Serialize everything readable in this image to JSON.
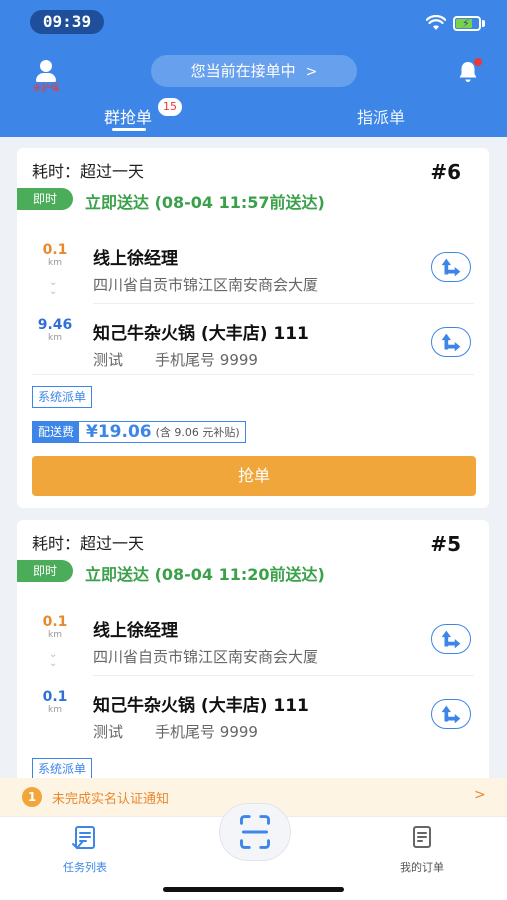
{
  "status_bar": {
    "time": "09:39"
  },
  "header": {
    "user_status": "未护保",
    "accepting_status": "您当前在接单中",
    "tabs": [
      {
        "label": "群抢单",
        "badge": "15",
        "active": true
      },
      {
        "label": "指派单",
        "active": false
      }
    ]
  },
  "orders": [
    {
      "elapsed": "耗时：超过一天",
      "number": "#6",
      "tag": "即时",
      "deliver": "立即送达 (08-04 11:57前送达)",
      "pickup": {
        "distance": "0.1",
        "unit": "km",
        "name": "线上徐经理",
        "address": "四川省自贡市锦江区南安商会大厦"
      },
      "dropoff": {
        "distance": "9.46",
        "unit": "km",
        "name": "知己牛杂火锅 (大丰店) 111",
        "contact": "测试",
        "phone": "手机尾号 9999"
      },
      "dispatch_tag": "系统派单",
      "fee_label": "配送费",
      "fee_value": "¥19.06",
      "fee_note": "(含 9.06 元补贴)",
      "grab_label": "抢单"
    },
    {
      "elapsed": "耗时：超过一天",
      "number": "#5",
      "tag": "即时",
      "deliver": "立即送达 (08-04 11:20前送达)",
      "pickup": {
        "distance": "0.1",
        "unit": "km",
        "name": "线上徐经理",
        "address": "四川省自贡市锦江区南安商会大厦"
      },
      "dropoff": {
        "distance": "0.1",
        "unit": "km",
        "name": "知己牛杂火锅 (大丰店) 111",
        "contact": "测试",
        "phone": "手机尾号 9999"
      },
      "dispatch_tag": "系统派单"
    }
  ],
  "notice": {
    "number": "1",
    "text": "未完成实名认证通知"
  },
  "bottom_nav": {
    "tasks_label": "任务列表",
    "orders_label": "我的订单"
  },
  "colors": {
    "primary": "#3d86e8",
    "accent_orange": "#f0a63a",
    "success_green": "#4bad5a",
    "alert_red": "#e83a3a"
  }
}
